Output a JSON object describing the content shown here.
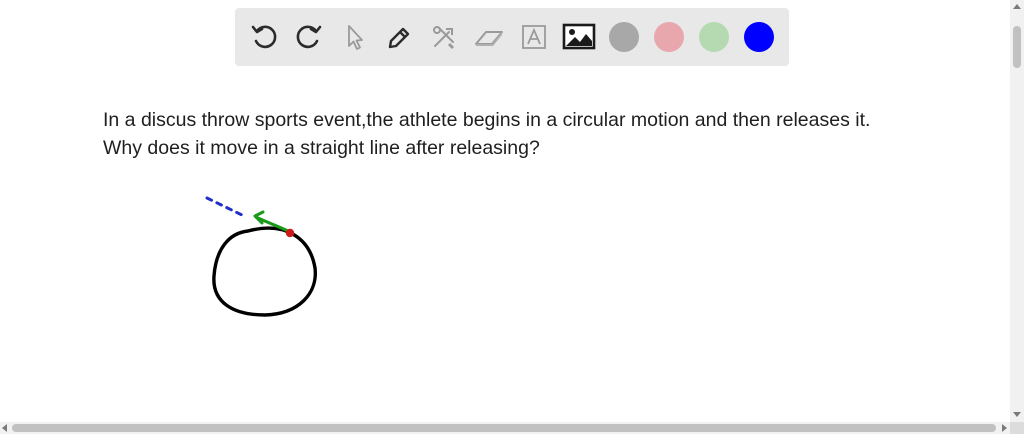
{
  "question": {
    "line1": "In a discus throw sports event,the athlete begins in a circular motion and then releases it.",
    "line2": "Why does it move in a straight line after releasing?"
  },
  "toolbar": {
    "tools": [
      "undo-icon",
      "redo-icon",
      "select-arrow-icon",
      "pen-icon",
      "tools-icon",
      "eraser-icon",
      "text-box-icon",
      "image-icon"
    ],
    "colors": [
      "#a8a8a8",
      "#e8a7ad",
      "#b5d9b0",
      "#0000ff"
    ]
  },
  "drawing": {
    "circle_color": "#000000",
    "tangent_arrow_color": "#1a9a1a",
    "release_point_color": "#cc1a1a",
    "path_dash_color": "#1f2fcc"
  }
}
